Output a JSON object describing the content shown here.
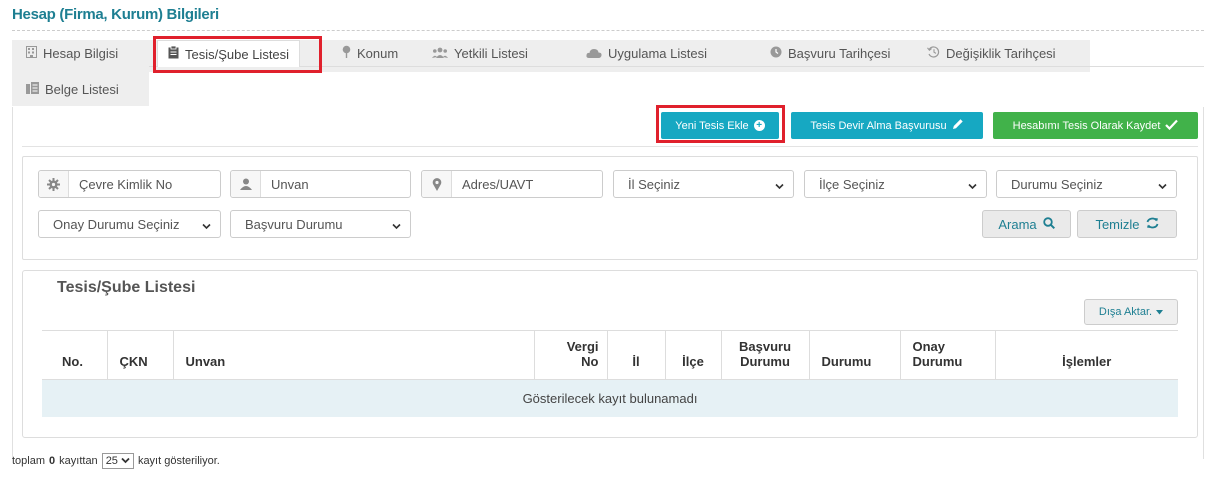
{
  "page_title": "Hesap (Firma, Kurum) Bilgileri",
  "tabs": [
    {
      "label": "Hesap Bilgisi",
      "icon": "building-icon"
    },
    {
      "label": "Tesis/Şube Listesi",
      "icon": "clipboard-icon",
      "active": true
    },
    {
      "label": "Konum",
      "icon": "map-pin-icon"
    },
    {
      "label": "Yetkili Listesi",
      "icon": "users-icon"
    },
    {
      "label": "Uygulama Listesi",
      "icon": "cloud-icon"
    },
    {
      "label": "Başvuru Tarihçesi",
      "icon": "clock-icon"
    },
    {
      "label": "Değişiklik Tarihçesi",
      "icon": "history-icon"
    },
    {
      "label": "Belge Listesi",
      "icon": "documents-icon"
    }
  ],
  "actions": {
    "new_facility": "Yeni Tesis Ekle",
    "transfer_application": "Tesis Devir Alma Başvurusu",
    "save_account_as_facility": "Hesabımı Tesis Olarak Kaydet"
  },
  "filters": {
    "ckn_placeholder": "Çevre Kimlik No",
    "title_placeholder": "Unvan",
    "address_placeholder": "Adres/UAVT",
    "province": "İl Seçiniz",
    "district": "İlçe Seçiniz",
    "status": "Durumu Seçiniz",
    "approval_status": "Onay Durumu Seçiniz",
    "application_status": "Başvuru Durumu",
    "search_button": "Arama",
    "clear_button": "Temizle"
  },
  "list": {
    "title": "Tesis/Şube Listesi",
    "export_button": "Dışa Aktar.",
    "columns": [
      {
        "label": "No."
      },
      {
        "label": "ÇKN"
      },
      {
        "label": "Unvan"
      },
      {
        "label": "Vergi No"
      },
      {
        "label": "İl"
      },
      {
        "label": "İlçe"
      },
      {
        "label": "Başvuru Durumu"
      },
      {
        "label": "Durumu"
      },
      {
        "label": "Onay Durumu"
      },
      {
        "label": "İşlemler"
      }
    ],
    "empty_message": "Gösterilecek kayıt bulunamadı"
  },
  "footer": {
    "prefix": "toplam",
    "total": "0",
    "middle": "kayıttan",
    "page_size": "25",
    "suffix": "kayıt gösteriliyor."
  },
  "colors": {
    "brand_teal": "#1e7f92",
    "cyan_button": "#16a8c2",
    "green_button": "#41b24a",
    "highlight_red": "#e0202c",
    "empty_row_bg": "#e6f1f5"
  }
}
